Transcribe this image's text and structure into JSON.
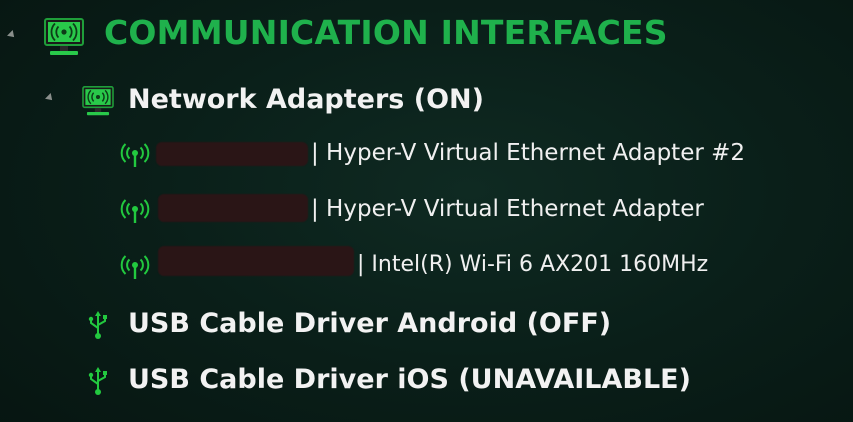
{
  "tree": {
    "root": {
      "label": "COMMUNICATION INTERFACES",
      "icon": "network-monitor-icon",
      "expanded": true,
      "accent_color": "#1fb14c"
    },
    "network_adapters": {
      "label": "Network Adapters (ON)",
      "icon": "network-monitor-icon",
      "expanded": true,
      "items": [
        {
          "name_redacted": true,
          "label": "| Hyper-V Virtual Ethernet Adapter #2",
          "icon": "wifi-signal-icon"
        },
        {
          "name_redacted": true,
          "label": "| Hyper-V Virtual Ethernet Adapter",
          "icon": "wifi-signal-icon"
        },
        {
          "name_redacted": true,
          "label": "| Intel(R) Wi-Fi 6 AX201 160MHz",
          "icon": "wifi-signal-icon"
        }
      ]
    },
    "usb_android": {
      "label": "USB Cable Driver Android (OFF)",
      "icon": "usb-icon"
    },
    "usb_ios": {
      "label": "USB Cable Driver iOS (UNAVAILABLE)",
      "icon": "usb-icon"
    }
  },
  "colors": {
    "icon_green": "#22c93f",
    "text_white": "#f0f0f0",
    "background": "#0a1f19"
  }
}
